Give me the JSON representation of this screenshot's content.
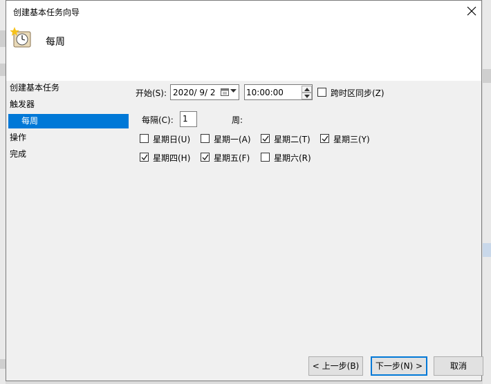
{
  "window": {
    "title": "创建基本任务向导"
  },
  "header": {
    "title": "每周",
    "icon": "scheduled-task-clock-icon"
  },
  "nav": {
    "items": [
      {
        "label": "创建基本任务"
      },
      {
        "label": "触发器"
      },
      {
        "label": "每周",
        "selected": true
      },
      {
        "label": "操作"
      },
      {
        "label": "完成"
      }
    ]
  },
  "start": {
    "label": "开始(S):",
    "date": "2020/  9/  2",
    "time": "10:00:00",
    "sync_label": "跨时区同步(Z)",
    "sync_checked": false
  },
  "recur": {
    "label": "每隔(C):",
    "value": "1",
    "unit": "周:"
  },
  "days": [
    {
      "label": "星期日(U)",
      "checked": false
    },
    {
      "label": "星期一(A)",
      "checked": false
    },
    {
      "label": "星期二(T)",
      "checked": true
    },
    {
      "label": "星期三(Y)",
      "checked": true
    },
    {
      "label": "星期四(H)",
      "checked": true
    },
    {
      "label": "星期五(F)",
      "checked": true
    },
    {
      "label": "星期六(R)",
      "checked": false
    }
  ],
  "buttons": {
    "back": "< 上一步(B)",
    "next": "下一步(N) >",
    "cancel": "取消"
  },
  "colors": {
    "accent": "#0078d7",
    "panel": "#f0f0f0"
  }
}
